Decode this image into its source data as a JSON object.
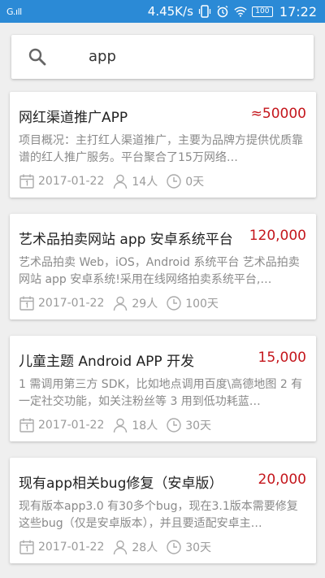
{
  "status_bar": {
    "signal": "G.ıll",
    "net_speed": "4.45K/s",
    "battery": "100",
    "time": "17:22"
  },
  "search": {
    "query": "app"
  },
  "projects": [
    {
      "title": "网红渠道推广APP",
      "price": "≈50000",
      "description": "项目概况：主打红人渠道推广，主要为品牌方提供优质靠谱的红人推广服务。平台聚合了15万网络…",
      "date": "2017-01-22",
      "people": "14人",
      "days": "0天"
    },
    {
      "title": "艺术品拍卖网站 app 安卓系统平台",
      "price": "120,000",
      "description": "艺术品拍卖 Web，iOS，Android 系统平台 艺术品拍卖网站 app 安卓系统!采用在线网络拍卖系统平台,…",
      "date": "2017-01-22",
      "people": "29人",
      "days": "100天"
    },
    {
      "title": "儿童主题 Android APP 开发",
      "price": "15,000",
      "description": "1 需调用第三方 SDK，比如地点调用百度\\高德地图 2 有一定社交功能，如关注粉丝等 3 用到低功耗蓝…",
      "date": "2017-01-22",
      "people": "18人",
      "days": "30天"
    },
    {
      "title": "现有app相关bug修复（安卓版）",
      "price": "20,000",
      "description": "现有版本app3.0 有30多个bug，现在3.1版本需要修复这些bug（仅是安卓版本），并且要适配安卓主…",
      "date": "2017-01-22",
      "people": "28人",
      "days": "30天"
    }
  ],
  "colors": {
    "status_bar": "#2b8ad6",
    "price": "#c4161c",
    "background": "#efefef"
  }
}
